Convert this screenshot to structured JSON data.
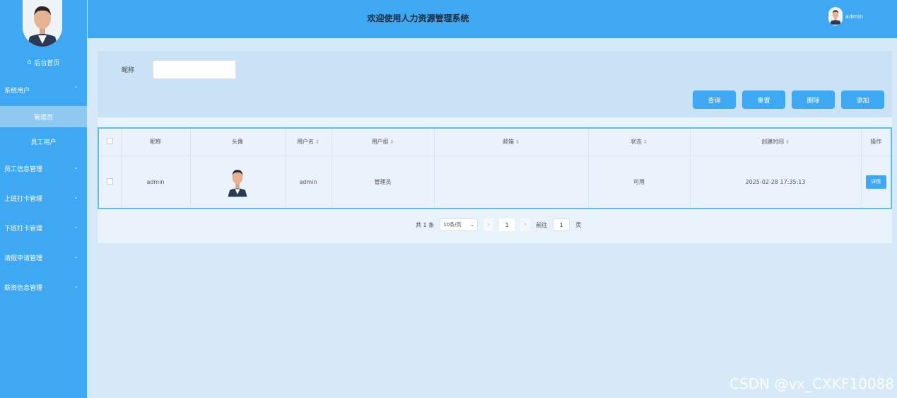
{
  "header": {
    "title": "欢迎使用人力资源管理系统",
    "username": "admin"
  },
  "sidebar": {
    "home_label": "后台首页",
    "groups": [
      {
        "label": "系统用户",
        "expanded": true,
        "children": [
          {
            "label": "管理员",
            "active": true
          },
          {
            "label": "员工用户",
            "active": false
          }
        ]
      },
      {
        "label": "员工信息管理"
      },
      {
        "label": "上班打卡管理"
      },
      {
        "label": "下班打卡管理"
      },
      {
        "label": "请假申请管理"
      },
      {
        "label": "薪资信息管理"
      }
    ]
  },
  "search": {
    "label": "昵称",
    "value": "",
    "placeholder": ""
  },
  "buttons": {
    "query": "查询",
    "reset": "重置",
    "delete": "删除",
    "add": "添加"
  },
  "table": {
    "headers": [
      "昵称",
      "头像",
      "用户名",
      "用户组",
      "邮箱",
      "状态",
      "创建时间",
      "操作"
    ],
    "rows": [
      {
        "nickname": "admin",
        "username": "admin",
        "group": "管理员",
        "email": "",
        "status": "可用",
        "created": "2025-02-28 17:35:13",
        "action": "详情"
      }
    ]
  },
  "pagination": {
    "total": "共 1 条",
    "page_size": "10条/页",
    "current": "1",
    "goto_prefix": "前往",
    "goto_value": "1",
    "goto_suffix": "页"
  },
  "watermark": "CSDN @vx_CXKF10088",
  "colors": {
    "primary": "#3ea8f2",
    "header_bg": "#3ea8f2",
    "content_bg": "#d7e9f8"
  }
}
